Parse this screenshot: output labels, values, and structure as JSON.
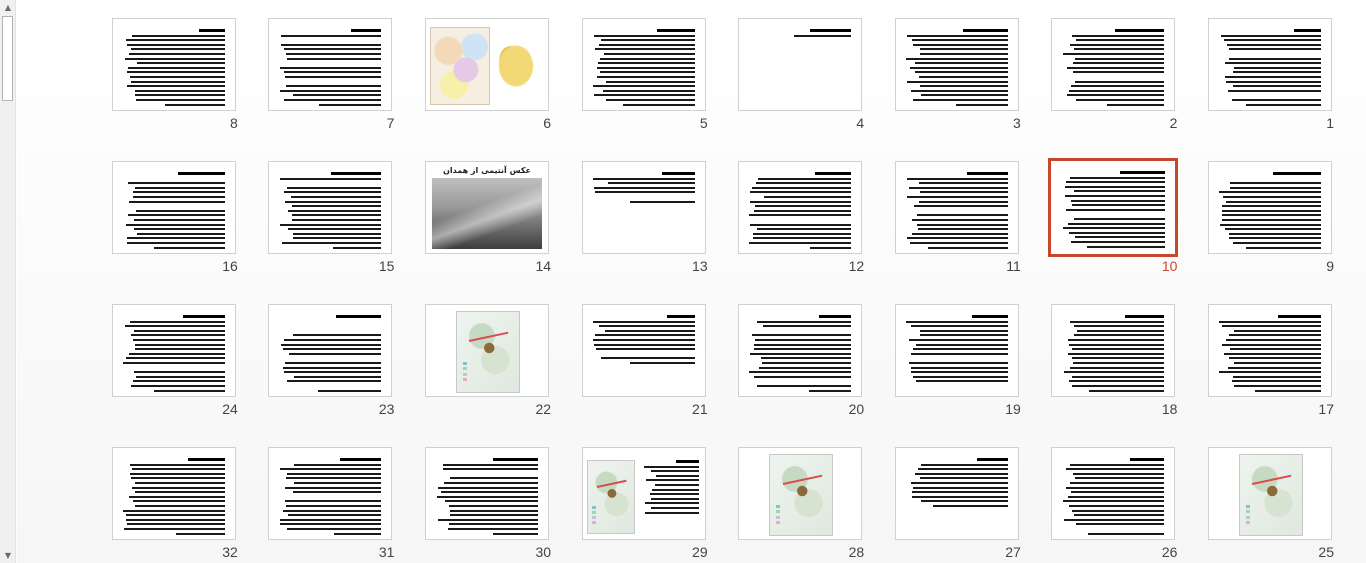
{
  "sorter": {
    "selected_slide": 10,
    "accent_color": "#c8472b",
    "slides": [
      {
        "number": "1",
        "kind": "text"
      },
      {
        "number": "2",
        "kind": "text"
      },
      {
        "number": "3",
        "kind": "text"
      },
      {
        "number": "4",
        "kind": "text"
      },
      {
        "number": "5",
        "kind": "text"
      },
      {
        "number": "6",
        "kind": "maps"
      },
      {
        "number": "7",
        "kind": "text"
      },
      {
        "number": "8",
        "kind": "text"
      },
      {
        "number": "9",
        "kind": "text"
      },
      {
        "number": "10",
        "kind": "text"
      },
      {
        "number": "11",
        "kind": "text"
      },
      {
        "number": "12",
        "kind": "text"
      },
      {
        "number": "13",
        "kind": "text"
      },
      {
        "number": "14",
        "kind": "photo",
        "caption": "عکس آنتیمی از همدان"
      },
      {
        "number": "15",
        "kind": "text"
      },
      {
        "number": "16",
        "kind": "text"
      },
      {
        "number": "17",
        "kind": "text"
      },
      {
        "number": "18",
        "kind": "text"
      },
      {
        "number": "19",
        "kind": "text"
      },
      {
        "number": "20",
        "kind": "text"
      },
      {
        "number": "21",
        "kind": "text"
      },
      {
        "number": "22",
        "kind": "map"
      },
      {
        "number": "23",
        "kind": "text"
      },
      {
        "number": "24",
        "kind": "text"
      },
      {
        "number": "25",
        "kind": "map"
      },
      {
        "number": "26",
        "kind": "text"
      },
      {
        "number": "27",
        "kind": "text"
      },
      {
        "number": "28",
        "kind": "map"
      },
      {
        "number": "29",
        "kind": "map-text"
      },
      {
        "number": "30",
        "kind": "text"
      },
      {
        "number": "31",
        "kind": "text"
      },
      {
        "number": "32",
        "kind": "text"
      }
    ]
  },
  "icons": {
    "scroll_up": "triangle-up-icon",
    "scroll_down": "triangle-down-icon"
  }
}
